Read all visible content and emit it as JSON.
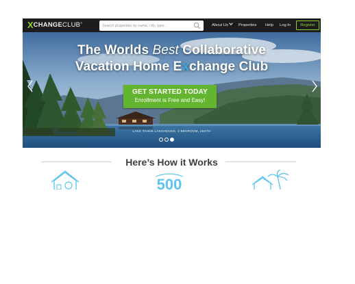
{
  "nav": {
    "logo": {
      "x": "X",
      "change": "CHANGE",
      "club": "CLUB",
      "tm": "®"
    },
    "search": {
      "placeholder": "Search properties by name, city, type..."
    },
    "about_label": "About Us",
    "properties_label": "Properties",
    "help_label": "Help",
    "login_label": "Log In",
    "register_label": "Register"
  },
  "hero": {
    "headline_line1_start": "The Worlds ",
    "headline_line1_best": "Best",
    "headline_line1_end": " Collaborative",
    "headline_line2_start": "Vacation Home E",
    "headline_line2_x": "x",
    "headline_line2_end": "change Club",
    "cta_main": "GET STARTED TODAY",
    "cta_sub": "Enrollment is Free and Easy!",
    "caption": "LAKE TAHOE LAKEHOUSE, 3 BEDROOM, 2BATH",
    "slides": 3,
    "active_slide": 3
  },
  "how": {
    "title": "Here’s How it Works",
    "icons": [
      "house-icon",
      "points-counter-icon",
      "vacation-house-palm-icon"
    ]
  },
  "colors": {
    "accent_green": "#63b52f",
    "logo_green": "#8fcf3a",
    "x_blue": "#3aa7e0",
    "icon_blue": "#5ec4ee",
    "nav_bg": "#1c1c1c"
  }
}
